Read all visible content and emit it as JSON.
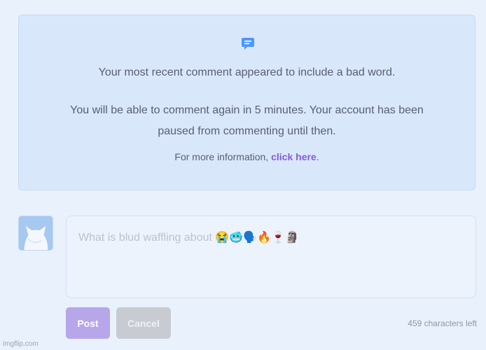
{
  "notice": {
    "icon": "comment-icon",
    "line1": "Your most recent comment appeared to include a bad word.",
    "line2": "You will be able to comment again in 5 minutes. Your account has been paused from commenting until then.",
    "line3_prefix": "For more information, ",
    "line3_link": "click here",
    "line3_suffix": "."
  },
  "avatar": {
    "icon": "cat-avatar-icon"
  },
  "composer": {
    "placeholder": "What is blud waffling about 😭🥶🗣️🔥🍷🗿",
    "value": ""
  },
  "actions": {
    "post_label": "Post",
    "cancel_label": "Cancel",
    "chars_left": "459 characters left"
  },
  "watermark": "imgflip.com",
  "colors": {
    "accent": "#855cd6",
    "notice_bg": "#d9e7fb",
    "page_bg": "#e9f1fc"
  }
}
